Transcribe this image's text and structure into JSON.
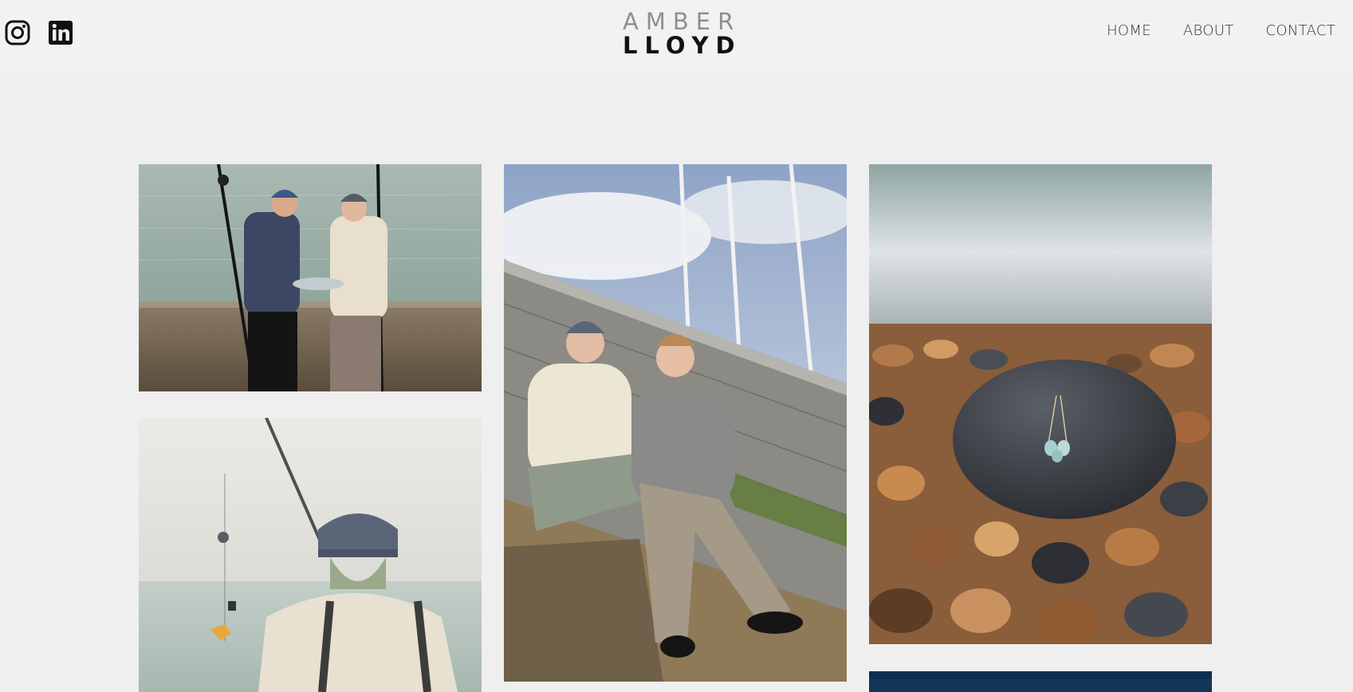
{
  "brand": {
    "line1": "AMBER",
    "line2": "LLOYD"
  },
  "social": [
    {
      "name": "instagram-icon"
    },
    {
      "name": "linkedin-icon"
    }
  ],
  "nav": [
    {
      "label": "HOME"
    },
    {
      "label": "ABOUT"
    },
    {
      "label": "CONTACT"
    }
  ],
  "gallery": [
    {
      "subject": "two men holding a fish in front of the sea wall with fishing rods"
    },
    {
      "subject": "two men sitting on a sea wall beneath sailboat masts"
    },
    {
      "subject": "sea glass pendant resting on a dark stone among pebbles"
    },
    {
      "subject": "man in a beanie looking out to sea with a fishing line"
    },
    {
      "subject": "dark blue water"
    }
  ],
  "colors": {
    "background": "#efefef",
    "header": "#f2f2f2",
    "text": "#333333"
  }
}
